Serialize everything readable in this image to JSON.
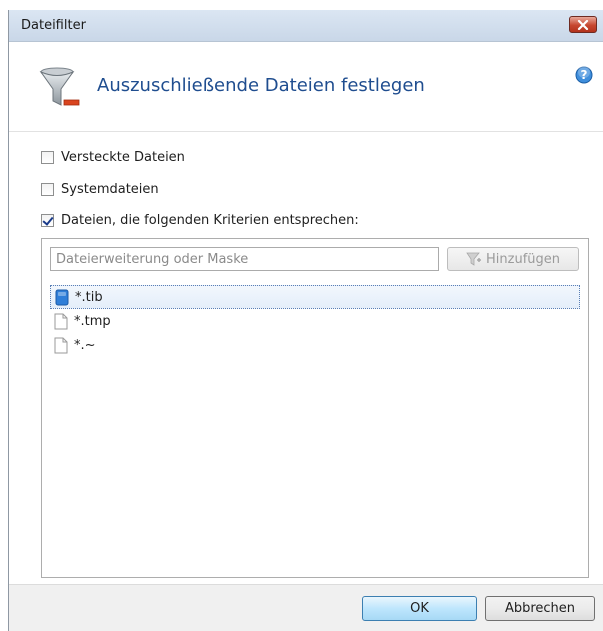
{
  "window": {
    "title": "Dateifilter"
  },
  "header": {
    "title": "Auszuschließende Dateien festlegen"
  },
  "options": [
    {
      "label": "Versteckte Dateien",
      "checked": false
    },
    {
      "label": "Systemdateien",
      "checked": false
    },
    {
      "label": "Dateien, die folgenden Kriterien entsprechen:",
      "checked": true
    }
  ],
  "filter": {
    "placeholder": "Dateierweiterung oder Maske",
    "add_label": "Hinzufügen",
    "items": [
      {
        "pattern": "*.tib",
        "icon": "tib-file-icon",
        "selected": true
      },
      {
        "pattern": "*.tmp",
        "icon": "blank-file-icon",
        "selected": false
      },
      {
        "pattern": "*.~",
        "icon": "blank-file-icon",
        "selected": false
      }
    ]
  },
  "footer": {
    "ok_label": "OK",
    "cancel_label": "Abbrechen"
  },
  "colors": {
    "accent": "#1f4d8f",
    "close": "#c7472f",
    "selection": "#e4eefa"
  }
}
